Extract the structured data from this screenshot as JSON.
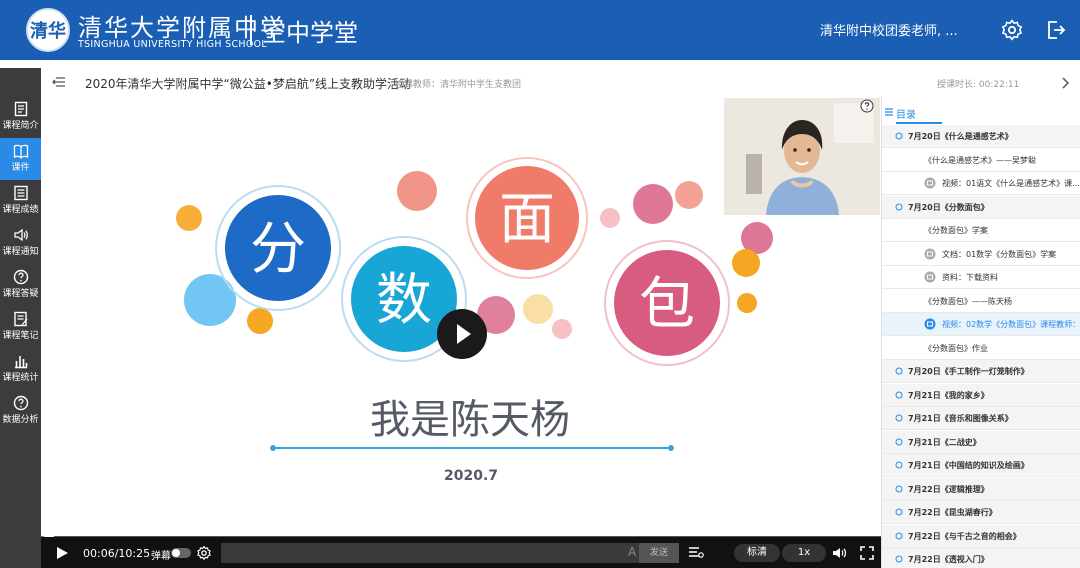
{
  "header": {
    "logo_mark": "清华",
    "school_name_cn": "清华大学附属中学",
    "school_name_en": "TSINGHUA UNIVERSITY HIGH SCHOOL",
    "brand": "空中学堂",
    "user_name": "清华附中校团委老师, ...",
    "accent": "#1a5fb4"
  },
  "sidebar": {
    "items": [
      {
        "label": "课程简介",
        "icon": "document-icon"
      },
      {
        "label": "课件",
        "icon": "book-icon"
      },
      {
        "label": "课程成绩",
        "icon": "grade-icon"
      },
      {
        "label": "课程通知",
        "icon": "speaker-icon"
      },
      {
        "label": "课程答疑",
        "icon": "question-icon"
      },
      {
        "label": "课程笔记",
        "icon": "notes-icon"
      },
      {
        "label": "课程统计",
        "icon": "bar-chart-icon"
      },
      {
        "label": "数据分析",
        "icon": "question-icon"
      }
    ],
    "active_index": 1
  },
  "titlebar": {
    "course_title": "2020年清华大学附属中学“微公益•梦启航”线上支教助学活动",
    "teacher": "授课教师：清华附中学生支教团",
    "duration": "授课时长: 00:22:11"
  },
  "slide": {
    "chars": [
      "分",
      "数",
      "面",
      "包"
    ],
    "presenter": "我是陈天杨",
    "date": "2020.7"
  },
  "player": {
    "time": "00:06/10:25",
    "danmu_label": "弹幕",
    "danmu_placeholder": "",
    "font_glyph": "A",
    "send_label": "发送",
    "quality": "标清",
    "speed": "1x",
    "progress_fraction": 0.0096
  },
  "toc": {
    "tab_label": "目录",
    "items": [
      {
        "text": "7月20日《什么是通感艺术》",
        "type": "chapter"
      },
      {
        "text": "《什么是通感艺术》——吴梦聪",
        "type": "section"
      },
      {
        "text": "视频：01语文《什么是通感艺术》课...",
        "type": "resource",
        "icon": "video-icon"
      },
      {
        "text": "7月20日《分数面包》",
        "type": "chapter"
      },
      {
        "text": "《分数面包》学案",
        "type": "section"
      },
      {
        "text": "文档：01数学《分数面包》学案",
        "type": "resource",
        "icon": "document-icon"
      },
      {
        "text": "资料：下载资料",
        "type": "resource",
        "icon": "download-icon"
      },
      {
        "text": "《分数面包》——陈天杨",
        "type": "section"
      },
      {
        "text": "视频：02数学《分数面包》课程教师：...",
        "type": "resource",
        "icon": "video-icon",
        "active": true
      },
      {
        "text": "《分数面包》作业",
        "type": "section"
      },
      {
        "text": "7月20日《手工制作一灯笼制作》",
        "type": "chapter"
      },
      {
        "text": "7月21日《我的家乡》",
        "type": "chapter"
      },
      {
        "text": "7月21日《音乐和图像关系》",
        "type": "chapter"
      },
      {
        "text": "7月21日《二战史》",
        "type": "chapter"
      },
      {
        "text": "7月21日《中国结的知识及绘画》",
        "type": "chapter"
      },
      {
        "text": "7月22日《逻辑推理》",
        "type": "chapter"
      },
      {
        "text": "7月22日《昆虫湖春行》",
        "type": "chapter"
      },
      {
        "text": "7月22日《与千古之音的相会》",
        "type": "chapter"
      },
      {
        "text": "7月22日《透视入门》",
        "type": "chapter"
      }
    ]
  }
}
